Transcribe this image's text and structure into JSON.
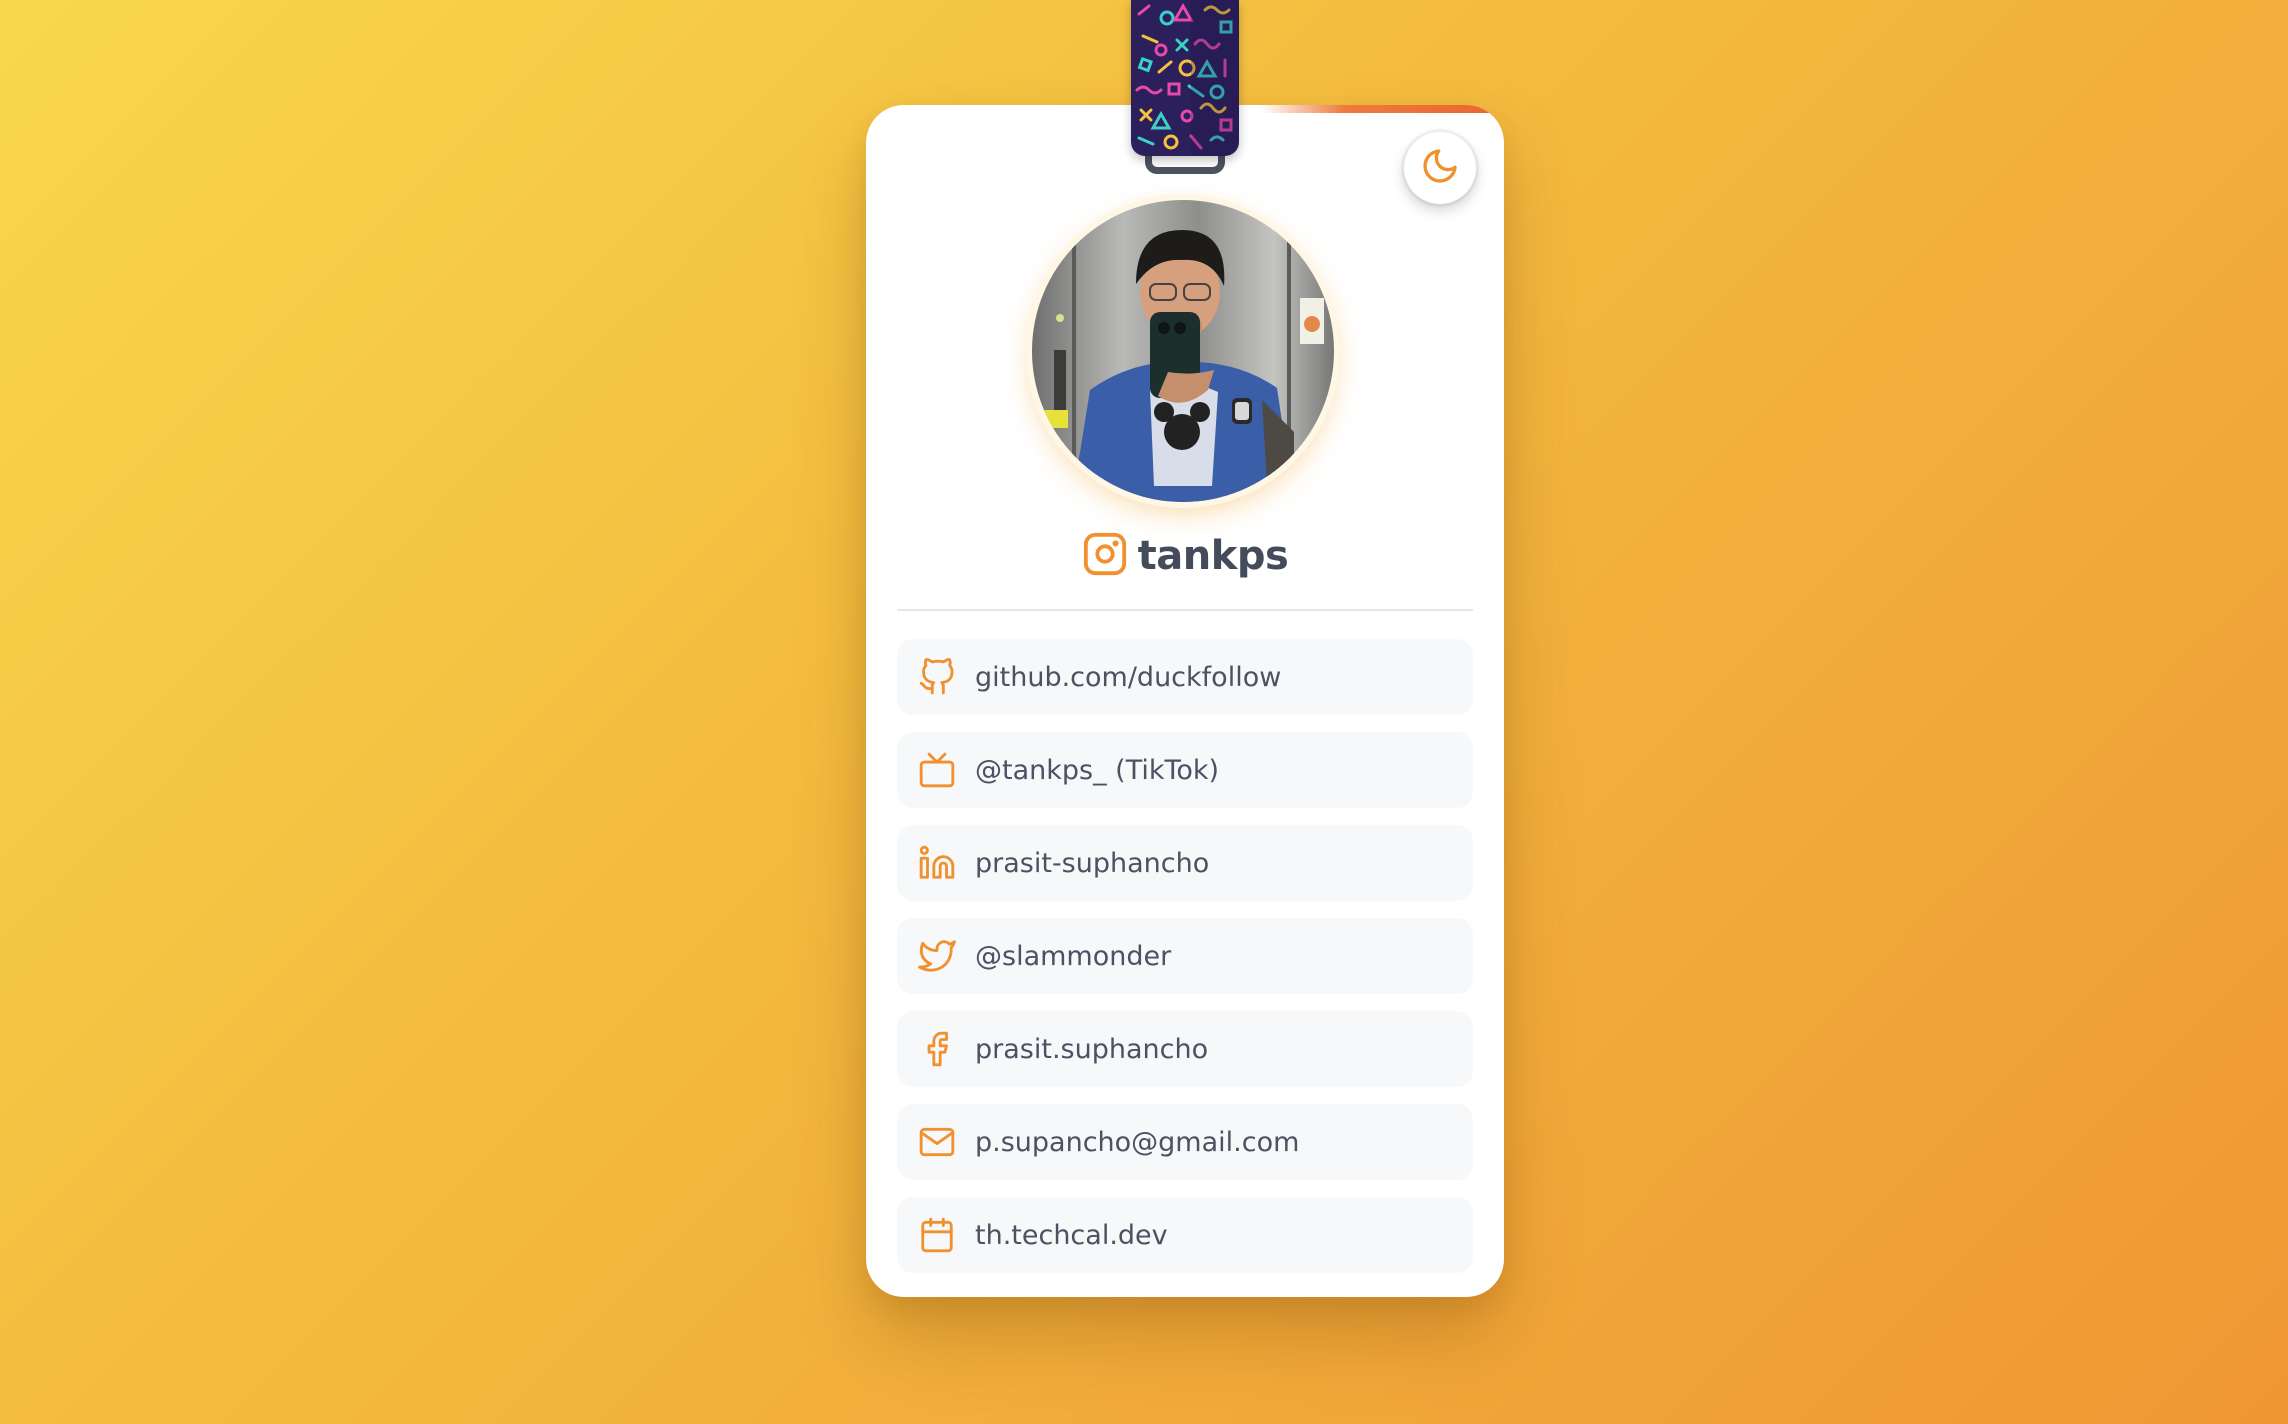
{
  "colors": {
    "accent": "#f0902f",
    "text": "#4b5261",
    "row_background": "#f7f8fa",
    "card_background": "#ffffff"
  },
  "header": {
    "theme_toggle_icon": "moon-icon"
  },
  "profile": {
    "avatar": "profile-photo",
    "handle_icon": "instagram-icon",
    "handle": "tankps"
  },
  "links": [
    {
      "icon": "github-icon",
      "label": "github.com/duckfollow"
    },
    {
      "icon": "tv-icon",
      "label": "@tankps_ (TikTok)"
    },
    {
      "icon": "linkedin-icon",
      "label": "prasit-suphancho"
    },
    {
      "icon": "twitter-icon",
      "label": "@slammonder"
    },
    {
      "icon": "facebook-icon",
      "label": "prasit.suphancho"
    },
    {
      "icon": "mail-icon",
      "label": "p.supancho@gmail.com"
    },
    {
      "icon": "calendar-icon",
      "label": "th.techcal.dev"
    }
  ]
}
